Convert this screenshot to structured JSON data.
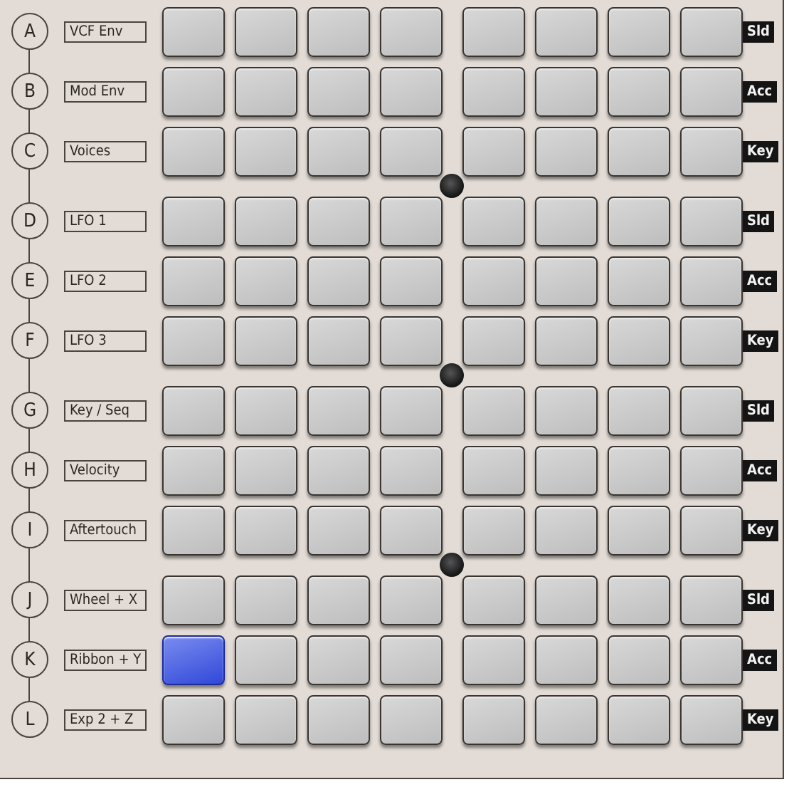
{
  "groups": [
    {
      "rows": [
        {
          "letter": "A",
          "label": "VCF Env",
          "tag": "Sld",
          "pads": [
            {
              "selected": false
            },
            {
              "selected": false
            },
            {
              "selected": false
            },
            {
              "selected": false
            },
            {
              "selected": false
            },
            {
              "selected": false
            },
            {
              "selected": false
            },
            {
              "selected": false
            }
          ]
        },
        {
          "letter": "B",
          "label": "Mod Env",
          "tag": "Acc",
          "pads": [
            {
              "selected": false
            },
            {
              "selected": false
            },
            {
              "selected": false
            },
            {
              "selected": false
            },
            {
              "selected": false
            },
            {
              "selected": false
            },
            {
              "selected": false
            },
            {
              "selected": false
            }
          ]
        },
        {
          "letter": "C",
          "label": "Voices",
          "tag": "Key",
          "pads": [
            {
              "selected": false
            },
            {
              "selected": false
            },
            {
              "selected": false
            },
            {
              "selected": false
            },
            {
              "selected": false
            },
            {
              "selected": false
            },
            {
              "selected": false
            },
            {
              "selected": false
            }
          ]
        }
      ]
    },
    {
      "rows": [
        {
          "letter": "D",
          "label": "LFO 1",
          "tag": "Sld",
          "pads": [
            {
              "selected": false
            },
            {
              "selected": false
            },
            {
              "selected": false
            },
            {
              "selected": false
            },
            {
              "selected": false
            },
            {
              "selected": false
            },
            {
              "selected": false
            },
            {
              "selected": false
            }
          ]
        },
        {
          "letter": "E",
          "label": "LFO 2",
          "tag": "Acc",
          "pads": [
            {
              "selected": false
            },
            {
              "selected": false
            },
            {
              "selected": false
            },
            {
              "selected": false
            },
            {
              "selected": false
            },
            {
              "selected": false
            },
            {
              "selected": false
            },
            {
              "selected": false
            }
          ]
        },
        {
          "letter": "F",
          "label": "LFO 3",
          "tag": "Key",
          "pads": [
            {
              "selected": false
            },
            {
              "selected": false
            },
            {
              "selected": false
            },
            {
              "selected": false
            },
            {
              "selected": false
            },
            {
              "selected": false
            },
            {
              "selected": false
            },
            {
              "selected": false
            }
          ]
        }
      ]
    },
    {
      "rows": [
        {
          "letter": "G",
          "label": "Key / Seq",
          "tag": "Sld",
          "pads": [
            {
              "selected": false
            },
            {
              "selected": false
            },
            {
              "selected": false
            },
            {
              "selected": false
            },
            {
              "selected": false
            },
            {
              "selected": false
            },
            {
              "selected": false
            },
            {
              "selected": false
            }
          ]
        },
        {
          "letter": "H",
          "label": "Velocity",
          "tag": "Acc",
          "pads": [
            {
              "selected": false
            },
            {
              "selected": false
            },
            {
              "selected": false
            },
            {
              "selected": false
            },
            {
              "selected": false
            },
            {
              "selected": false
            },
            {
              "selected": false
            },
            {
              "selected": false
            }
          ]
        },
        {
          "letter": "I",
          "label": "Aftertouch",
          "tag": "Key",
          "pads": [
            {
              "selected": false
            },
            {
              "selected": false
            },
            {
              "selected": false
            },
            {
              "selected": false
            },
            {
              "selected": false
            },
            {
              "selected": false
            },
            {
              "selected": false
            },
            {
              "selected": false
            }
          ]
        }
      ]
    },
    {
      "rows": [
        {
          "letter": "J",
          "label": "Wheel + X",
          "tag": "Sld",
          "pads": [
            {
              "selected": false
            },
            {
              "selected": false
            },
            {
              "selected": false
            },
            {
              "selected": false
            },
            {
              "selected": false
            },
            {
              "selected": false
            },
            {
              "selected": false
            },
            {
              "selected": false
            }
          ]
        },
        {
          "letter": "K",
          "label": "Ribbon + Y",
          "tag": "Acc",
          "pads": [
            {
              "selected": true
            },
            {
              "selected": false
            },
            {
              "selected": false
            },
            {
              "selected": false
            },
            {
              "selected": false
            },
            {
              "selected": false
            },
            {
              "selected": false
            },
            {
              "selected": false
            }
          ]
        },
        {
          "letter": "L",
          "label": "Exp 2 + Z",
          "tag": "Key",
          "pads": [
            {
              "selected": false
            },
            {
              "selected": false
            },
            {
              "selected": false
            },
            {
              "selected": false
            },
            {
              "selected": false
            },
            {
              "selected": false
            },
            {
              "selected": false
            },
            {
              "selected": false
            }
          ]
        }
      ]
    }
  ]
}
